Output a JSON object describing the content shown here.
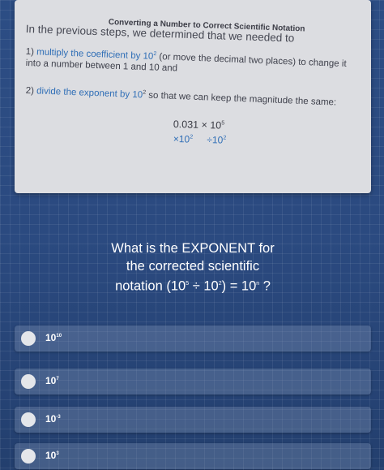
{
  "card": {
    "title": "Converting a Number to Correct Scientific Notation",
    "intro": "In the previous steps, we determined that we needed to",
    "step1": {
      "prefix": "1) ",
      "highlight": "multiply the coefficient by 10",
      "exponent": "2",
      "rest": " (or move the decimal two places) to change it",
      "line2": "into a number between 1 and 10 and"
    },
    "step2": {
      "prefix": "2) ",
      "highlight": "divide the exponent by 10",
      "exponent": "2",
      "rest": " so that we can keep the magnitude the same:"
    },
    "expression": "0.031 × 10",
    "expression_exponent": "5",
    "multiply_op": "×10",
    "multiply_exp": "2",
    "divide_op": "÷10",
    "divide_exp": "2"
  },
  "question": {
    "line1": "What is the EXPONENT for",
    "line2": "the corrected scientific",
    "line3_a": "notation (10",
    "line3_exp1": "5",
    "line3_b": " ÷ 10",
    "line3_exp2": "2",
    "line3_c": ") = 10",
    "line3_exp3": "n",
    "line3_d": " ?"
  },
  "options": [
    {
      "base": "10",
      "exp": "10"
    },
    {
      "base": "10",
      "exp": "7"
    },
    {
      "base": "10",
      "exp": "-3"
    },
    {
      "base": "10",
      "exp": "3"
    }
  ],
  "colors": {
    "background": "#2a4a7e",
    "card": "#dcdde1",
    "highlight_text": "#2f6eb6",
    "option_bg": "#5a6f95"
  }
}
